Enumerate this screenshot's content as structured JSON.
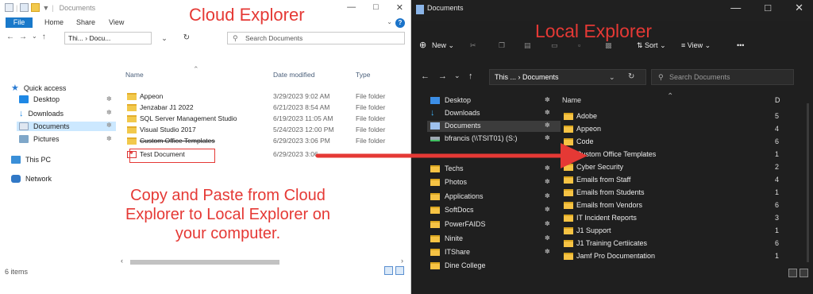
{
  "cloud": {
    "annotation_title": "Cloud Explorer",
    "window_title": "Documents",
    "ribbon": {
      "file": "File",
      "tabs": [
        "Home",
        "Share",
        "View"
      ]
    },
    "address": {
      "path": "Thi... › Docu...",
      "search_placeholder": "Search Documents"
    },
    "nav": [
      {
        "label": "Quick access"
      },
      {
        "label": "Desktop"
      },
      {
        "label": "Downloads"
      },
      {
        "label": "Documents"
      },
      {
        "label": "Pictures"
      },
      {
        "label": "This PC"
      },
      {
        "label": "Network"
      }
    ],
    "columns": {
      "name": "Name",
      "date": "Date modified",
      "type": "Type"
    },
    "files": [
      {
        "name": "Appeon",
        "date": "3/29/2023 9:02 AM",
        "type": "File folder"
      },
      {
        "name": "Jenzabar J1 2022",
        "date": "6/21/2023 8:54 AM",
        "type": "File folder"
      },
      {
        "name": "SQL Server Management Studio",
        "date": "6/19/2023 11:05 AM",
        "type": "File folder"
      },
      {
        "name": "Visual Studio 2017",
        "date": "5/24/2023 12:00 PM",
        "type": "File folder"
      },
      {
        "name": "Custom Office Templates",
        "date": "6/29/2023 3:06 PM",
        "type": "File folder"
      },
      {
        "name": "Test Document",
        "date": "6/29/2023 3:06",
        "type": ""
      }
    ],
    "instruction": "Copy and Paste from Cloud Explorer to Local Explorer on your computer.",
    "status": "6 items"
  },
  "local": {
    "annotation_title": "Local Explorer",
    "window_title": "Documents",
    "toolbar": {
      "new": "New",
      "sort": "Sort",
      "view": "View",
      "more": "•••"
    },
    "address": {
      "path": "This ... › Documents",
      "search_placeholder": "Search Documents"
    },
    "nav": [
      {
        "label": "Desktop",
        "icon": "desktop"
      },
      {
        "label": "Downloads",
        "icon": "download"
      },
      {
        "label": "Documents",
        "icon": "documents"
      },
      {
        "label": "bfrancis (\\\\TSIT01) (S:)",
        "icon": "drive"
      },
      {
        "label": "Techs",
        "icon": "folder"
      },
      {
        "label": "Photos",
        "icon": "folder"
      },
      {
        "label": "Applications",
        "icon": "folder"
      },
      {
        "label": "SoftDocs",
        "icon": "folder"
      },
      {
        "label": "PowerFAIDS",
        "icon": "folder"
      },
      {
        "label": "Ninite",
        "icon": "folder"
      },
      {
        "label": "ITShare",
        "icon": "folder"
      },
      {
        "label": "Dine College",
        "icon": "folder"
      }
    ],
    "columns": {
      "name": "Name",
      "date_trunc": "D"
    },
    "files": [
      {
        "name": "Adobe",
        "num": "5"
      },
      {
        "name": "Appeon",
        "num": "4"
      },
      {
        "name": "Code",
        "num": "6"
      },
      {
        "name": "Custom Office Templates",
        "num": "1"
      },
      {
        "name": "Cyber Security",
        "num": "2"
      },
      {
        "name": "Emails from Staff",
        "num": "4"
      },
      {
        "name": "Emails from Students",
        "num": "1"
      },
      {
        "name": "Emails from Vendors",
        "num": "6"
      },
      {
        "name": "IT Incident Reports",
        "num": "3"
      },
      {
        "name": "J1 Support",
        "num": "1"
      },
      {
        "name": "J1 Training Certiicates",
        "num": "6"
      },
      {
        "name": "Jamf Pro Documentation",
        "num": "1"
      }
    ]
  },
  "colors": {
    "annotation_red": "#e53935",
    "dark_bg": "#1f1f1f",
    "folder_yellow": "#f2c94c",
    "accent_blue": "#1979ca"
  }
}
